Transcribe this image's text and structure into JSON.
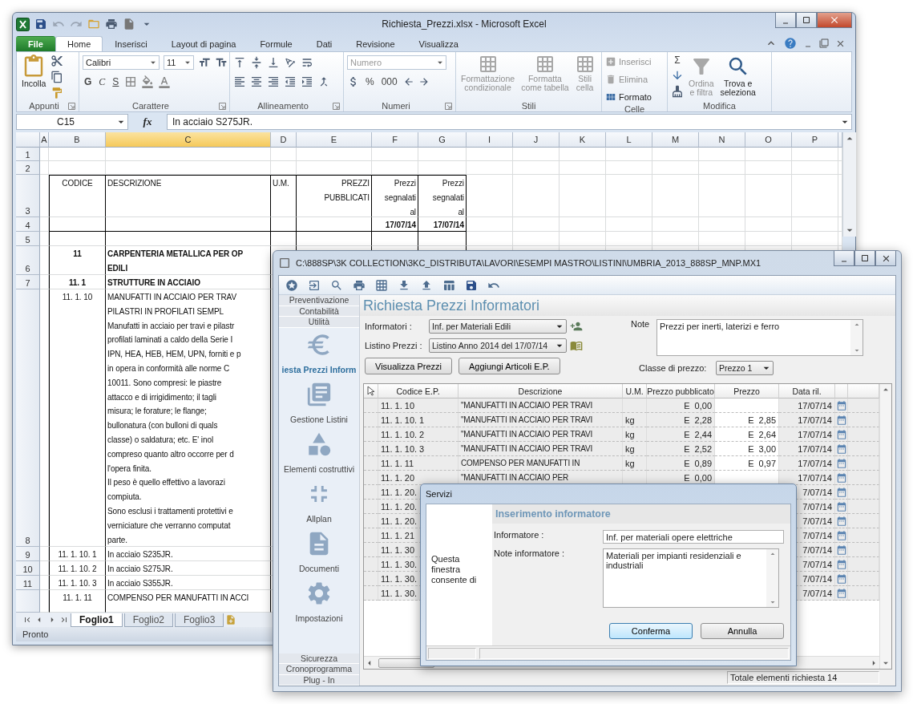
{
  "excel": {
    "title": "Richiesta_Prezzi.xlsx - Microsoft Excel",
    "tabs": [
      {
        "label": "File",
        "kind": "file",
        "selected": false
      },
      {
        "label": "Home",
        "kind": "tab",
        "selected": true
      },
      {
        "label": "Inserisci",
        "kind": "tab",
        "selected": false
      },
      {
        "label": "Layout di pagina",
        "kind": "tab",
        "selected": false
      },
      {
        "label": "Formule",
        "kind": "tab",
        "selected": false
      },
      {
        "label": "Dati",
        "kind": "tab",
        "selected": false
      },
      {
        "label": "Revisione",
        "kind": "tab",
        "selected": false
      },
      {
        "label": "Visualizza",
        "kind": "tab",
        "selected": false
      }
    ],
    "ribbon_groups": [
      {
        "label": "Appunti",
        "launcher": true,
        "controls": [
          {
            "kind": "big",
            "label": "Incolla",
            "disabled": false
          }
        ]
      },
      {
        "label": "Carattere",
        "launcher": true,
        "controls": [
          {
            "kind": "combo",
            "value": "Calibri",
            "disabled": false
          },
          {
            "kind": "combo",
            "value": "11",
            "disabled": false
          },
          {
            "kind": "glyph",
            "label": "G"
          },
          {
            "kind": "glyph",
            "label": "C"
          },
          {
            "kind": "glyph",
            "label": "S"
          }
        ]
      },
      {
        "label": "Allineamento",
        "launcher": true
      },
      {
        "label": "Numeri",
        "launcher": true,
        "controls": [
          {
            "kind": "combo",
            "value": "Numero",
            "disabled": true
          },
          {
            "kind": "glyph",
            "label": "%"
          },
          {
            "kind": "glyph",
            "label": "000"
          }
        ]
      },
      {
        "label": "Stili",
        "launcher": false,
        "controls": [
          {
            "kind": "big",
            "label": "Formattazione\ncondizionale",
            "disabled": true
          },
          {
            "kind": "big",
            "label": "Formatta\ncome tabella",
            "disabled": true
          },
          {
            "kind": "big",
            "label": "Stili\ncella",
            "disabled": true
          }
        ]
      },
      {
        "label": "Celle",
        "launcher": false,
        "controls": [
          {
            "kind": "small",
            "label": "Inserisci",
            "disabled": true
          },
          {
            "kind": "small",
            "label": "Elimina",
            "disabled": true
          },
          {
            "kind": "small",
            "label": "Formato",
            "disabled": false
          }
        ]
      },
      {
        "label": "Modifica",
        "launcher": false,
        "controls": [
          {
            "kind": "glyph",
            "label": "Σ"
          },
          {
            "kind": "big",
            "label": "Ordina\ne filtra",
            "disabled": true
          },
          {
            "kind": "big",
            "label": "Trova e\nseleziona",
            "disabled": false
          }
        ]
      }
    ],
    "formula_bar": {
      "name_box": "C15",
      "function_label": "fx",
      "formula": "In acciaio S275JR."
    },
    "columns": [
      {
        "label": "A",
        "selected": false
      },
      {
        "label": "B",
        "selected": false
      },
      {
        "label": "C",
        "selected": true
      },
      {
        "label": "D",
        "selected": false
      },
      {
        "label": "E",
        "selected": false
      },
      {
        "label": "F",
        "selected": false
      },
      {
        "label": "G",
        "selected": false
      },
      {
        "label": "I",
        "selected": false
      },
      {
        "label": "J",
        "selected": false
      },
      {
        "label": "K",
        "selected": false
      },
      {
        "label": "L",
        "selected": false
      },
      {
        "label": "M",
        "selected": false
      },
      {
        "label": "N",
        "selected": false
      },
      {
        "label": "O",
        "selected": false
      },
      {
        "label": "P",
        "selected": false
      }
    ],
    "rows": [
      {
        "number": "1"
      },
      {
        "number": "2"
      },
      {
        "number": "3",
        "bold": false,
        "cells": {
          "B": "CODICE",
          "C": "DESCRIZIONE",
          "D": "U.M.",
          "E": "PREZZI\nPUBBLICATI",
          "F": "Prezzi\nsegnalati\nal",
          "G": "Prezzi\nsegnalati\nal"
        }
      },
      {
        "number": "4",
        "bold": true,
        "cells": {
          "F": "17/07/14",
          "G": "17/07/14"
        }
      },
      {
        "number": "5"
      },
      {
        "number": "6",
        "bold": true,
        "cells": {
          "B": "11",
          "C": "CARPENTERIA METALLICA PER OP\nEDILI"
        }
      },
      {
        "number": "7",
        "bold": true,
        "cells": {
          "B": "11. 1",
          "C": "STRUTTURE IN ACCIAIO"
        }
      },
      {
        "number": "8",
        "bold": false,
        "cells": {
          "B": "11. 1. 10",
          "C": "MANUFATTI IN ACCIAIO PER TRAV\nPILASTRI IN PROFILATI SEMPL\nManufatti in acciaio per travi e pilastr\nprofilati laminati a caldo della Serie I\nIPN, HEA, HEB, HEM, UPN, forniti e p\nin opera in conformità alle norme C\n10011. Sono compresi: le piastre\nattacco e di irrigidimento; il tagli\nmisura; le forature; le flange;\nbullonatura (con bulloni di quals\nclasse) o saldatura; etc. E' inol\ncompreso quanto altro occorre per d\nl'opera finita.\nIl peso è quello effettivo a lavorazi\ncompiuta.\nSono esclusi i trattamenti protettivi e\nverniciature che verranno computat\nparte."
        }
      },
      {
        "number": "9",
        "bold": false,
        "cells": {
          "B": "11. 1. 10. 1",
          "C": "In acciaio S235JR."
        }
      },
      {
        "number": "10",
        "bold": false,
        "cells": {
          "B": "11. 1. 10. 2",
          "C": "In acciaio S275JR."
        }
      },
      {
        "number": "11",
        "bold": false,
        "cells": {
          "B": "11. 1. 10. 3",
          "C": "In acciaio S355JR."
        }
      },
      {
        "bold": false,
        "cells": {
          "B": "11. 1. 11",
          "C": "COMPENSO PER MANUFATTI IN ACCI"
        }
      }
    ],
    "sheet_tabs": [
      {
        "label": "Foglio1",
        "selected": true
      },
      {
        "label": "Foglio2",
        "selected": false
      },
      {
        "label": "Foglio3",
        "selected": false
      }
    ],
    "status": "Pronto"
  },
  "app": {
    "title": "C:\\888SP\\3K COLLECTION\\3KC_DISTRIBUTA\\LAVORI\\ESEMPI MASTRO\\LISTINI\\UMBRIA_2013_888SP_MNP.MX1",
    "sidebar": {
      "top_sections": [
        "Preventivazione",
        "Contabilità",
        "Utilità"
      ],
      "items": [
        {
          "label": "iesta Prezzi Inform",
          "selected": true
        },
        {
          "label": "Gestione Listini",
          "selected": false
        },
        {
          "label": "Elementi costruttivi",
          "selected": false
        },
        {
          "label": "Allplan",
          "selected": false
        },
        {
          "label": "Documenti",
          "selected": false
        },
        {
          "label": "Impostazioni",
          "selected": false
        }
      ],
      "bottom_sections": [
        "Sicurezza",
        "Cronoprogramma",
        "Plug - In"
      ]
    },
    "heading": "Richiesta Prezzi Informatori",
    "form": {
      "informatori_label": "Informatori :",
      "informatori_value": "Inf. per Materiali Edili",
      "listino_label": "Listino Prezzi :",
      "listino_value": "Listino Anno 2014 del 17/07/14",
      "note_label": "Note",
      "note_value": "Prezzi per inerti, laterizi e ferro",
      "classe_label": "Classe di prezzo:",
      "classe_value": "Prezzo 1"
    },
    "buttons": [
      "Visualizza Prezzi",
      "Aggiungi Articoli E.P."
    ],
    "table": {
      "columns": [
        "Codice E.P.",
        "Descrizione",
        "U.M.",
        "Prezzo pubblicato",
        "Prezzo",
        "Data ril."
      ],
      "rows": [
        {
          "code": "11. 1. 10",
          "description": "\"MANUFATTI IN ACCIAIO PER TRAVI",
          "published": "E  0,00",
          "date": "17/07/14"
        },
        {
          "code": "11. 1. 10. 1",
          "description": "\"MANUFATTI IN ACCIAIO PER TRAVI",
          "unit": "kg",
          "published": "E  2,28",
          "price": "E  2,85",
          "date": "17/07/14"
        },
        {
          "code": "11. 1. 10. 2",
          "description": "\"MANUFATTI IN ACCIAIO PER TRAVI",
          "unit": "kg",
          "published": "E  2,44",
          "price": "E  2,64",
          "date": "17/07/14"
        },
        {
          "code": "11. 1. 10. 3",
          "description": "\"MANUFATTI IN ACCIAIO PER TRAVI",
          "unit": "kg",
          "published": "E  2,52",
          "price": "E  3,00",
          "date": "17/07/14"
        },
        {
          "code": "11. 1. 11",
          "description": "COMPENSO PER MANUFATTI IN",
          "unit": "kg",
          "published": "E  0,89",
          "price": "E  0,97",
          "date": "17/07/14"
        },
        {
          "code": "11. 1. 20",
          "description": "\"MANUFATTI IN ACCIAIO PER",
          "published": "E  0,00",
          "date": "17/07/14"
        },
        {
          "code": "11. 1. 20.",
          "date": "7/07/14"
        },
        {
          "code": "11. 1. 20.",
          "date": "7/07/14"
        },
        {
          "code": "11. 1. 20.",
          "date": "7/07/14"
        },
        {
          "code": "11. 1. 21",
          "date": "7/07/14"
        },
        {
          "code": "11. 1. 30",
          "date": "7/07/14"
        },
        {
          "code": "11. 1. 30.",
          "date": "7/07/14"
        },
        {
          "code": "11. 1. 30.",
          "date": "7/07/14"
        },
        {
          "code": "11. 1. 30.",
          "date": "7/07/14"
        }
      ]
    },
    "status_bar": "Totale elementi richiesta 14"
  },
  "dialog": {
    "title": "Servizi",
    "intro": "Questa finestra consente di",
    "heading": "Inserimento informatore",
    "informatore_label": "Informatore :",
    "informatore_value": "Inf. per materiali opere elettriche",
    "note_label": "Note informatore :",
    "note_value": "Materiali per impianti residenziali e industriali",
    "buttons": [
      {
        "label": "Conferma",
        "default": true
      },
      {
        "label": "Annulla",
        "default": false
      }
    ]
  }
}
